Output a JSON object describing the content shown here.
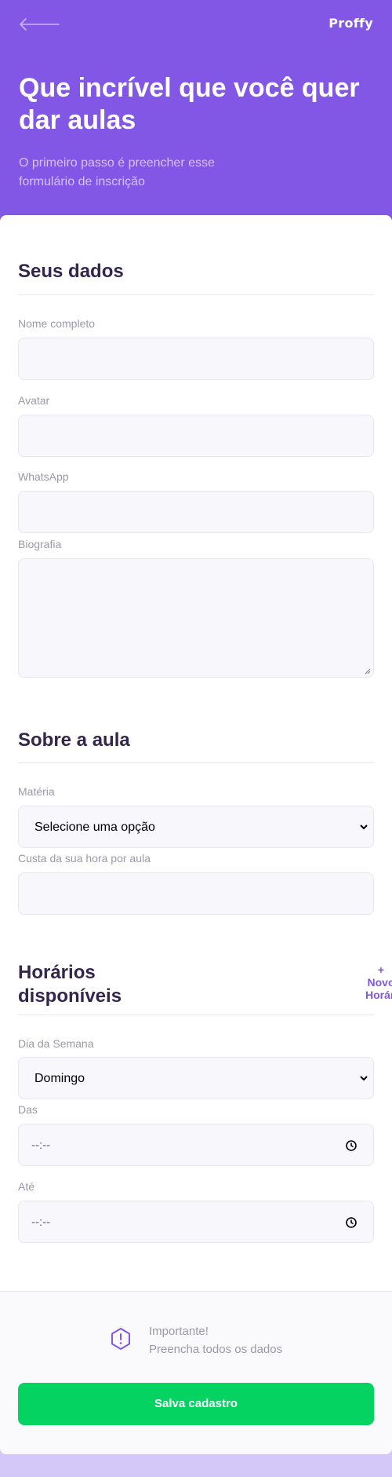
{
  "header": {
    "brand": "Proffy",
    "title": "Que incrível que você quer dar aulas",
    "subtitle": "O primeiro passo é preencher esse formulário de inscrição",
    "back_icon": "arrow-left-icon"
  },
  "sections": {
    "personal": {
      "title": "Seus dados",
      "name_label": "Nome completo",
      "name_value": "",
      "avatar_label": "Avatar",
      "avatar_value": "",
      "whatsapp_label": "WhatsApp",
      "whatsapp_value": "",
      "bio_label": "Biografia",
      "bio_value": ""
    },
    "class": {
      "title": "Sobre a aula",
      "subject_label": "Matéria",
      "subject_value": "Selecione uma opção",
      "cost_label": "Custa da sua hora por aula",
      "cost_value": ""
    },
    "schedule": {
      "title_line1": "Horários",
      "title_line2": "disponíveis",
      "add_line1": "+",
      "add_line2": "Novo",
      "add_line3": "Horário",
      "weekday_label": "Dia da Semana",
      "weekday_value": "Domingo",
      "from_label": "Das",
      "from_value": "--:--",
      "to_label": "Até",
      "to_value": "--:--"
    }
  },
  "footer": {
    "warning_title": "Importante!",
    "warning_text": "Preencha todos os dados",
    "warning_icon": "warning-icon",
    "save_label": "Salva cadastro"
  },
  "colors": {
    "primary": "#8257e5",
    "background": "#d4c8f8",
    "title": "#32264d",
    "label": "#9c98a6",
    "input_bg": "#f8f8fc",
    "success": "#04d361"
  }
}
